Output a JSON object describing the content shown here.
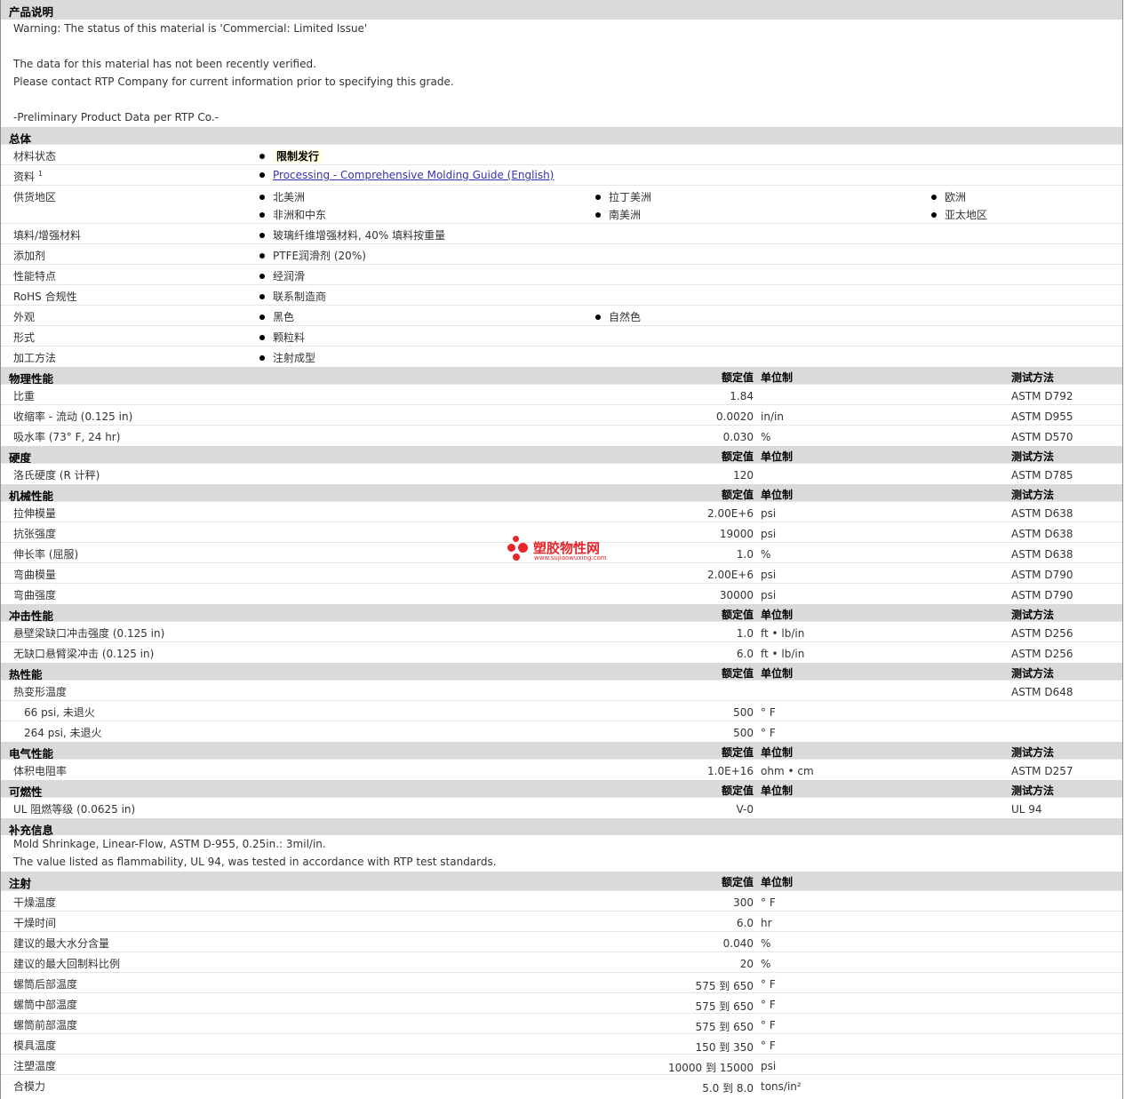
{
  "desc": {
    "title": "产品说明",
    "lines": [
      "Warning: The status of this material is 'Commercial: Limited Issue'",
      "",
      "The data for this material has not been recently verified.",
      "Please contact RTP Company for current information prior to specifying this grade.",
      "",
      "-Preliminary Product Data per RTP Co.-"
    ]
  },
  "general": {
    "title": "总体",
    "status_label": "材料状态",
    "status_value": "限制发行",
    "docs_label": "资料",
    "docs_sup": "1",
    "docs_link": "Processing - Comprehensive Molding Guide (English)",
    "regions_label": "供货地区",
    "regions": [
      "北美洲",
      "拉丁美洲",
      "欧洲",
      "非洲和中东",
      "南美洲",
      "亚太地区"
    ],
    "filler_label": "填料/增强材料",
    "filler_value": "玻璃纤维增强材料, 40% 填料按重量",
    "additive_label": "添加剂",
    "additive_value": "PTFE润滑剂 (20%)",
    "feature_label": "性能特点",
    "feature_value": "经润滑",
    "rohs_label": "RoHS 合规性",
    "rohs_value": "联系制造商",
    "appearance_label": "外观",
    "appearance_values": [
      "黑色",
      "自然色"
    ],
    "form_label": "形式",
    "form_value": "颗粒料",
    "processing_label": "加工方法",
    "processing_value": "注射成型"
  },
  "headers": {
    "rated": "额定值",
    "unit": "单位制",
    "method": "测试方法"
  },
  "physical": {
    "title": "物理性能",
    "rows": [
      {
        "label": "比重",
        "value": "1.84",
        "unit": "",
        "method": "ASTM D792"
      },
      {
        "label": "收缩率 - 流动 (0.125 in)",
        "value": "0.0020",
        "unit": "in/in",
        "method": "ASTM D955"
      },
      {
        "label": "吸水率 (73° F, 24 hr)",
        "value": "0.030",
        "unit": "%",
        "method": "ASTM D570"
      }
    ]
  },
  "hardness": {
    "title": "硬度",
    "rows": [
      {
        "label": "洛氏硬度 (R 计秤)",
        "value": "120",
        "unit": "",
        "method": "ASTM D785"
      }
    ]
  },
  "mechanical": {
    "title": "机械性能",
    "rows": [
      {
        "label": "拉伸模量",
        "value": "2.00E+6",
        "unit": "psi",
        "method": "ASTM D638"
      },
      {
        "label": "抗张强度",
        "value": "19000",
        "unit": "psi",
        "method": "ASTM D638"
      },
      {
        "label": "伸长率 (屈服)",
        "value": "1.0",
        "unit": "%",
        "method": "ASTM D638"
      },
      {
        "label": "弯曲模量",
        "value": "2.00E+6",
        "unit": "psi",
        "method": "ASTM D790"
      },
      {
        "label": "弯曲强度",
        "value": "30000",
        "unit": "psi",
        "method": "ASTM D790"
      }
    ]
  },
  "impact": {
    "title": "冲击性能",
    "rows": [
      {
        "label": "悬壁梁缺口冲击强度 (0.125 in)",
        "value": "1.0",
        "unit": "ft • lb/in",
        "method": "ASTM D256"
      },
      {
        "label": "无缺口悬臂梁冲击 (0.125 in)",
        "value": "6.0",
        "unit": "ft • lb/in",
        "method": "ASTM D256"
      }
    ]
  },
  "thermal": {
    "title": "热性能",
    "hdt_label": "热变形温度",
    "hdt_method": "ASTM D648",
    "rows": [
      {
        "label": "66 psi, 未退火",
        "value": "500",
        "unit": "° F"
      },
      {
        "label": "264 psi, 未退火",
        "value": "500",
        "unit": "° F"
      }
    ]
  },
  "electrical": {
    "title": "电气性能",
    "rows": [
      {
        "label": "体积电阻率",
        "value": "1.0E+16",
        "unit": "ohm • cm",
        "method": "ASTM D257"
      }
    ]
  },
  "flammability": {
    "title": "可燃性",
    "rows": [
      {
        "label": "UL 阻燃等级 (0.0625 in)",
        "value": "V-0",
        "unit": "",
        "method": "UL 94"
      }
    ]
  },
  "supplement": {
    "title": "补充信息",
    "lines": [
      "Mold Shrinkage, Linear-Flow, ASTM D-955, 0.25in.: 3mil/in.",
      "The value listed as flammability, UL 94, was tested in accordance with RTP test standards."
    ]
  },
  "injection": {
    "title": "注射",
    "rows": [
      {
        "label": "干燥温度",
        "value": "300",
        "unit": "° F"
      },
      {
        "label": "干燥时间",
        "value": "6.0",
        "unit": "hr"
      },
      {
        "label": "建议的最大水分含量",
        "value": "0.040",
        "unit": "%"
      },
      {
        "label": "建议的最大回制料比例",
        "value": "20",
        "unit": "%"
      },
      {
        "label": "螺筒后部温度",
        "value": "575 到  650",
        "unit": "° F"
      },
      {
        "label": "螺筒中部温度",
        "value": "575 到  650",
        "unit": "° F"
      },
      {
        "label": "螺筒前部温度",
        "value": "575 到  650",
        "unit": "° F"
      },
      {
        "label": "模具温度",
        "value": "150 到  350",
        "unit": "° F"
      },
      {
        "label": "注塑温度",
        "value": "10000 到  15000",
        "unit": "psi"
      },
      {
        "label": "合模力",
        "value": "5.0 到  8.0",
        "unit": "tons/in²"
      }
    ]
  },
  "watermark": {
    "title": "塑胶物性网",
    "url": "www.sujiaowuxing.com",
    "color": "#e8262b"
  }
}
